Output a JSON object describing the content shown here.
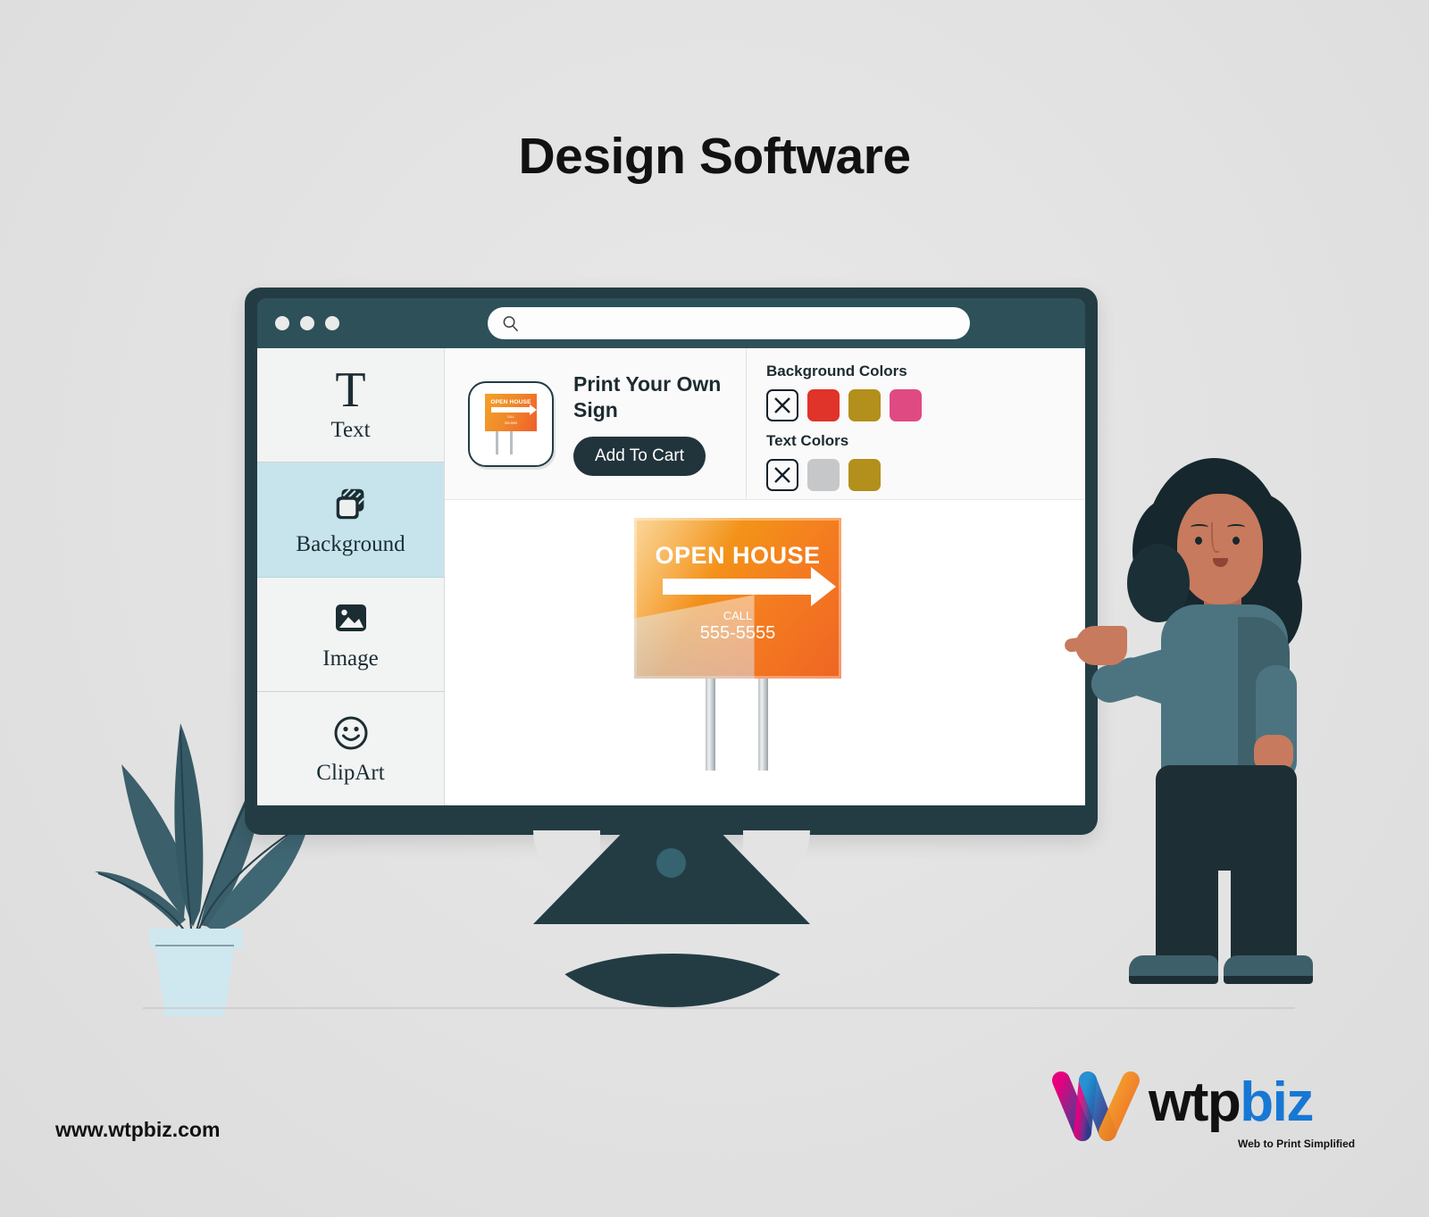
{
  "page": {
    "title": "Design Software",
    "background_color": "#e3e3e3"
  },
  "browser": {
    "titlebar_color": "#2d5059",
    "window_dots": [
      "dot-1",
      "dot-2",
      "dot-3"
    ],
    "search": {
      "icon": "search-icon",
      "value": "",
      "placeholder": ""
    }
  },
  "sidebar": {
    "items": [
      {
        "label": "Text",
        "icon": "text-T-icon",
        "active": false
      },
      {
        "label": "Background",
        "icon": "layers-icon",
        "active": true
      },
      {
        "label": "Image",
        "icon": "image-icon",
        "active": false
      },
      {
        "label": "ClipArt",
        "icon": "smiley-icon",
        "active": false
      }
    ],
    "active_color": "#c7e4ec"
  },
  "product": {
    "title": "Print Your Own Sign",
    "add_to_cart_label": "Add To Cart",
    "thumbnail": {
      "headline": "OPEN HOUSE",
      "call_label": "CALL",
      "phone": "555-5555"
    }
  },
  "colors_panel": {
    "background_label": "Background Colors",
    "background_swatches": [
      {
        "name": "none",
        "hex": "transparent"
      },
      {
        "name": "red",
        "hex": "#e0332a"
      },
      {
        "name": "gold",
        "hex": "#b38f1b"
      },
      {
        "name": "pink",
        "hex": "#e04a82"
      }
    ],
    "text_label": "Text Colors",
    "text_swatches": [
      {
        "name": "none",
        "hex": "transparent"
      },
      {
        "name": "silver",
        "hex": "#c6c7c8"
      },
      {
        "name": "gold",
        "hex": "#b38f1b"
      }
    ]
  },
  "canvas": {
    "sign": {
      "headline": "OPEN HOUSE",
      "call_label": "CALL",
      "phone": "555-5555",
      "gradient_from": "#f5a623",
      "gradient_to": "#ef6524",
      "arrow": "right-arrow-icon"
    }
  },
  "decor": {
    "plant": "potted-plant-illustration",
    "person": "woman-pointing-illustration"
  },
  "footer": {
    "url": "www.wtpbiz.com",
    "logo_primary": "wtp",
    "logo_secondary": "biz",
    "tagline": "Web to Print Simplified",
    "logo_accent": "#1778d4"
  }
}
